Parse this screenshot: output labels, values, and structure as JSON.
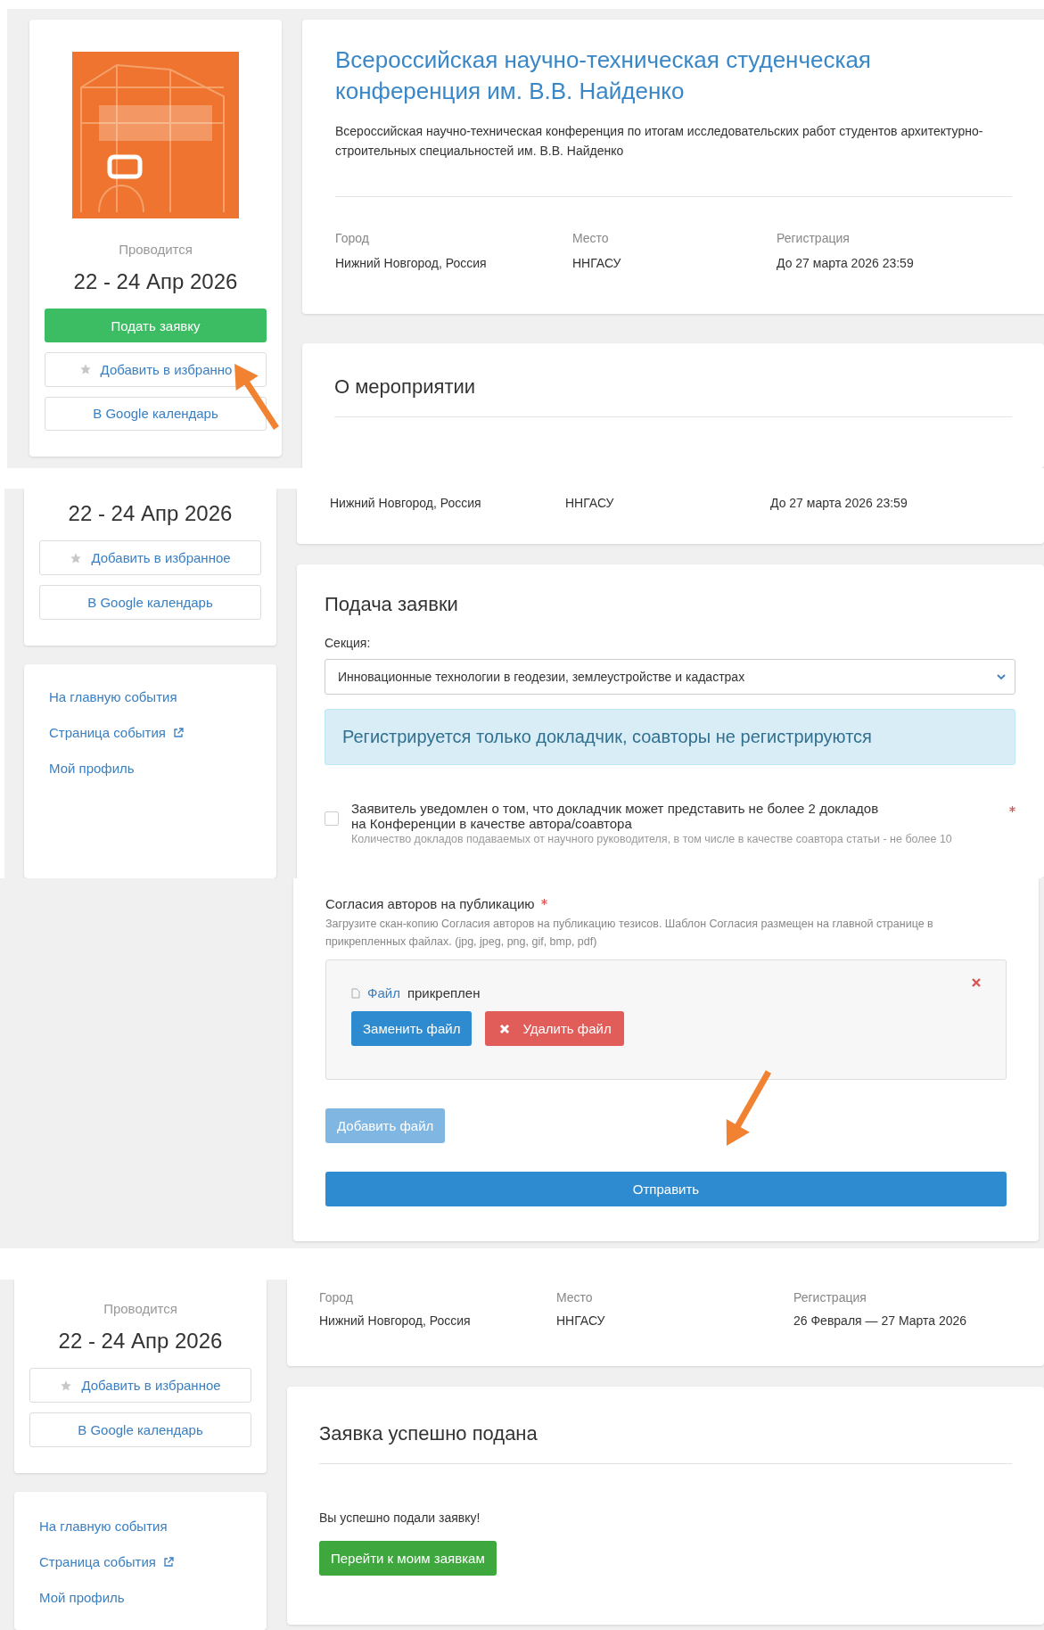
{
  "screens": [
    {
      "kind": "overview",
      "sidebar": {
        "status": "Проводится",
        "dates": "22 - 24 Апр 2026",
        "buttons": [
          {
            "kind": "primary",
            "label": "Подать заявку"
          },
          {
            "kind": "favorite",
            "label": "Добавить в избранно"
          },
          {
            "kind": "plain",
            "label": "В Google календарь"
          }
        ]
      },
      "event": {
        "title": "Всероссийская научно-техническая студенческая конференция им. В.В. Найденко",
        "description": "Всероссийская научно-техническая конференция по итогам исследовательских работ студентов архитектурно-строительных специальностей им. В.В. Найденко",
        "facts": [
          {
            "label": "Город",
            "value": "Нижний Новгород, Россия"
          },
          {
            "label": "Место",
            "value": "ННГАСУ"
          },
          {
            "label": "Регистрация",
            "value": "До 27 марта 2026 23:59"
          }
        ]
      },
      "next_card": {
        "title": "О мероприятии"
      }
    },
    {
      "kind": "application",
      "sidebar": {
        "dates": "22 - 24 Апр 2026",
        "buttons": [
          {
            "kind": "favorite",
            "label": "Добавить в избранное"
          },
          {
            "kind": "plain",
            "label": "В Google календарь"
          }
        ],
        "links": [
          {
            "label": "На главную события",
            "external": false
          },
          {
            "label": "Страница события",
            "external": true
          },
          {
            "label": "Мой профиль",
            "external": false
          }
        ]
      },
      "facts": [
        {
          "value": "Нижний Новгород, Россия"
        },
        {
          "value": "ННГАСУ"
        },
        {
          "value": "До 27 марта 2026 23:59"
        }
      ],
      "form": {
        "title": "Подача заявки",
        "field_label": "Секция:",
        "section_value": "Инновационные технологии в геодезии, землеустройстве и кадастрах",
        "notice": "Регистрируется только докладчик, соавторы не регистрируются",
        "checkbox": {
          "label": "Заявитель уведомлен о том, что докладчик может представить не более 2 докладов на Конференции в качестве автора/соавтора",
          "checked": false,
          "required": true,
          "hint": "Количество докладов подаваемых от научного руководителя, в том числе в качестве соавтора статьи - не более 10"
        }
      }
    },
    {
      "kind": "upload",
      "field": {
        "label": "Согласия авторов на публикацию",
        "required": true,
        "help": "Загрузите скан-копию Согласия авторов на публикацию тезисов. Шаблон Согласия размещен на главной странице в прикрепленных файлах. (jpg, jpeg, png, gif, bmp, pdf)"
      },
      "attachment": {
        "link": "Файл",
        "text": "прикреплен",
        "buttons": [
          {
            "kind": "replace",
            "label": "Заменить файл"
          },
          {
            "kind": "delete",
            "label": "Удалить файл"
          }
        ]
      },
      "add_button": {
        "label": "Добавить файл",
        "disabled": true
      },
      "submit": "Отправить"
    },
    {
      "kind": "success",
      "sidebar": {
        "status": "Проводится",
        "dates": "22 - 24 Апр 2026",
        "buttons": [
          {
            "kind": "favorite",
            "label": "Добавить в избранное"
          },
          {
            "kind": "plain",
            "label": "В Google календарь"
          }
        ],
        "links": [
          {
            "label": "На главную события",
            "external": false
          },
          {
            "label": "Страница события",
            "external": true
          },
          {
            "label": "Мой профиль",
            "external": false
          }
        ]
      },
      "facts": [
        {
          "label": "Город",
          "value": "Нижний Новгород, Россия"
        },
        {
          "label": "Место",
          "value": "ННГАСУ"
        },
        {
          "label": "Регистрация",
          "value": "26 Февраля — 27 Марта 2026"
        }
      ],
      "result": {
        "title": "Заявка успешно подана",
        "message": "Вы успешно подали заявку!",
        "button": "Перейти к моим заявкам"
      }
    }
  ]
}
